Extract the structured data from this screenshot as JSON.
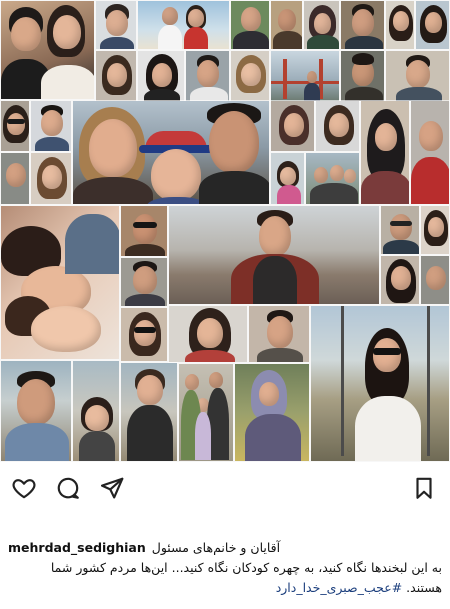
{
  "post": {
    "username": "mehrdad_sedighian",
    "caption_line1": "آقایان و خانم‌های مسئول",
    "caption_line2": "به این لبخندها نگاه کنید، به چهره کودکان نگاه کنید... این‌ها مردم کشور شما",
    "caption_line3_text": "هستند.",
    "caption_hashtag": "#عجب_صبری_خدا_دارد"
  },
  "actions": {
    "like_icon": "heart-icon",
    "comment_icon": "comment-bubble-icon",
    "share_icon": "paper-plane-icon",
    "save_icon": "bookmark-icon"
  },
  "colors": {
    "hashtag": "#1a3d7c",
    "icon_stroke": "#222222"
  }
}
